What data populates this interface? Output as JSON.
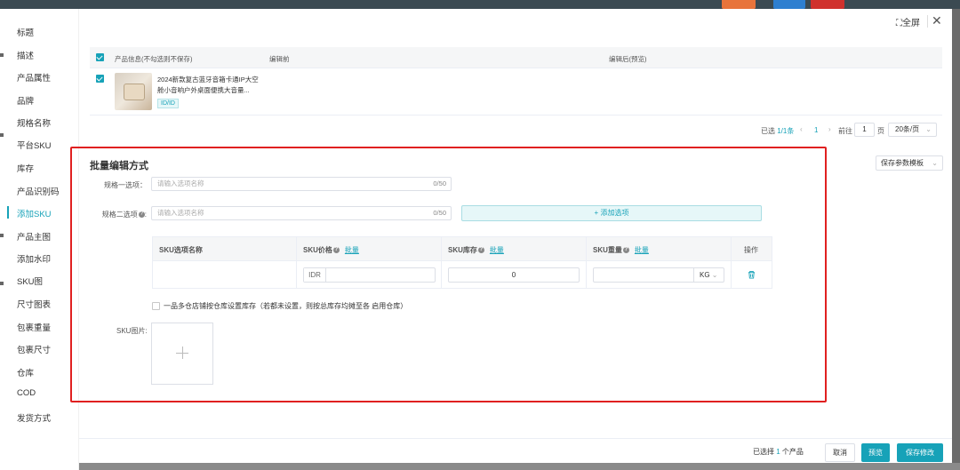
{
  "header": {
    "fullscreen_label": "全屏",
    "fullscreen_icon": "expand-icon",
    "close_icon": "close-icon"
  },
  "sidebar": {
    "items": [
      {
        "label": "标题",
        "active": false
      },
      {
        "label": "描述",
        "active": false
      },
      {
        "label": "产品属性",
        "active": false
      },
      {
        "label": "品牌",
        "active": false
      },
      {
        "label": "规格名称",
        "active": false
      },
      {
        "label": "平台SKU",
        "active": false
      },
      {
        "label": "库存",
        "active": false
      },
      {
        "label": "产品识别码",
        "active": false
      },
      {
        "label": "添加SKU",
        "active": true
      },
      {
        "label": "产品主图",
        "active": false
      },
      {
        "label": "添加水印",
        "active": false
      },
      {
        "label": "SKU图",
        "active": false
      },
      {
        "label": "尺寸图表",
        "active": false
      },
      {
        "label": "包裹重量",
        "active": false
      },
      {
        "label": "包裹尺寸",
        "active": false
      },
      {
        "label": "仓库",
        "active": false
      },
      {
        "label": "COD",
        "active": false
      },
      {
        "label": "发货方式",
        "active": false
      }
    ]
  },
  "table": {
    "columns": [
      "产品信息(不勾选则不保存)",
      "编辑前",
      "编辑后(预览)"
    ],
    "rows": [
      {
        "title": "2024新款复古蓝牙音箱卡通IP大空舱小音响户外桌面便携大音量...",
        "tag": "ID/ID",
        "checked": true
      }
    ]
  },
  "pagination": {
    "selected_prefix": "已选 ",
    "selected_count": "1/1条",
    "prev": "‹",
    "page": "1",
    "next": "›",
    "goto_label": "前往",
    "goto_value": "1",
    "page_unit": "页",
    "page_size": "20条/页"
  },
  "save_template": {
    "label": "保存参数模板"
  },
  "batch": {
    "title": "批量编辑方式",
    "option1": {
      "label": "规格一选项：",
      "placeholder": "请输入选项名称",
      "count": "0/50"
    },
    "option2": {
      "label": "规格二选项",
      "placeholder": "请输入选项名称",
      "count": "0/50"
    },
    "add_option": "+ 添加选项",
    "grid": {
      "headers": {
        "name": "SKU选项名称",
        "price": "SKU价格",
        "stock": "SKU库存",
        "weight": "SKU重量",
        "action": "操作"
      },
      "batch_link": "批量",
      "row": {
        "price_prefix": "IDR",
        "stock": "0",
        "weight_unit": "KG"
      }
    },
    "multi_warehouse": "一品多仓店铺按仓库设置库存（若都未设置，则按总库存均摊至各 启用仓库）",
    "sku_image_label": "SKU图片:"
  },
  "footer": {
    "selected_prefix": "已选择 ",
    "selected_count": "1",
    "selected_suffix": " 个产品",
    "cancel": "取消",
    "preview": "预览",
    "save": "保存修改"
  },
  "colors": {
    "accent": "#17a2b8",
    "highlight": "#e02020"
  }
}
